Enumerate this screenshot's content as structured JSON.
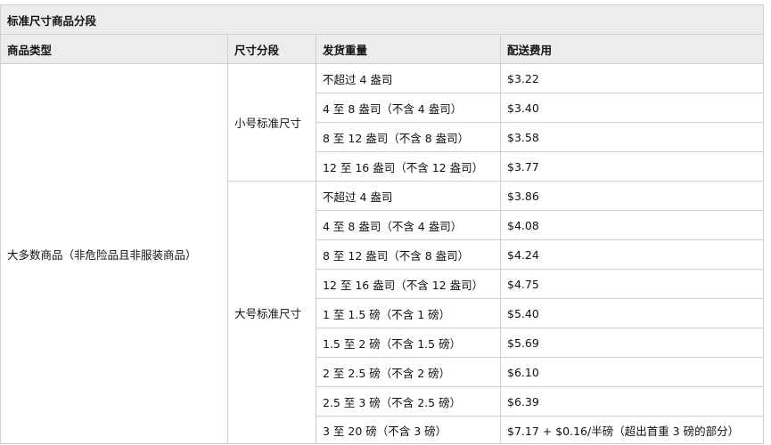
{
  "table": {
    "caption": "标准尺寸商品分段",
    "columns": [
      "商品类型",
      "尺寸分段",
      "发货重量",
      "配送费用"
    ],
    "category": "大多数商品（非危险品且非服装商品）",
    "tiers": [
      {
        "name": "小号标准尺寸",
        "rows": [
          {
            "weight": "不超过 4 盎司",
            "fee": "$3.22"
          },
          {
            "weight": "4 至 8 盎司（不含 4 盎司）",
            "fee": "$3.40"
          },
          {
            "weight": "8 至 12 盎司（不含 8 盎司）",
            "fee": "$3.58"
          },
          {
            "weight": "12 至 16 盎司（不含 12 盎司）",
            "fee": "$3.77"
          }
        ]
      },
      {
        "name": "大号标准尺寸",
        "rows": [
          {
            "weight": "不超过 4 盎司",
            "fee": "$3.86"
          },
          {
            "weight": "4 至 8 盎司（不含 4 盎司）",
            "fee": "$4.08"
          },
          {
            "weight": "8 至 12 盎司（不含 8 盎司）",
            "fee": "$4.24"
          },
          {
            "weight": "12 至 16 盎司（不含 12 盎司）",
            "fee": "$4.75"
          },
          {
            "weight": "1 至 1.5 磅（不含 1 磅）",
            "fee": "$5.40"
          },
          {
            "weight": "1.5 至 2 磅（不含 1.5 磅）",
            "fee": "$5.69"
          },
          {
            "weight": "2 至 2.5 磅（不含 2 磅）",
            "fee": "$6.10"
          },
          {
            "weight": "2.5 至 3 磅（不含 2.5 磅）",
            "fee": "$6.39"
          },
          {
            "weight": "3 至 20 磅（不含 3 磅）",
            "fee": "$7.17 + $0.16/半磅（超出首重 3 磅的部分）"
          }
        ]
      }
    ]
  }
}
